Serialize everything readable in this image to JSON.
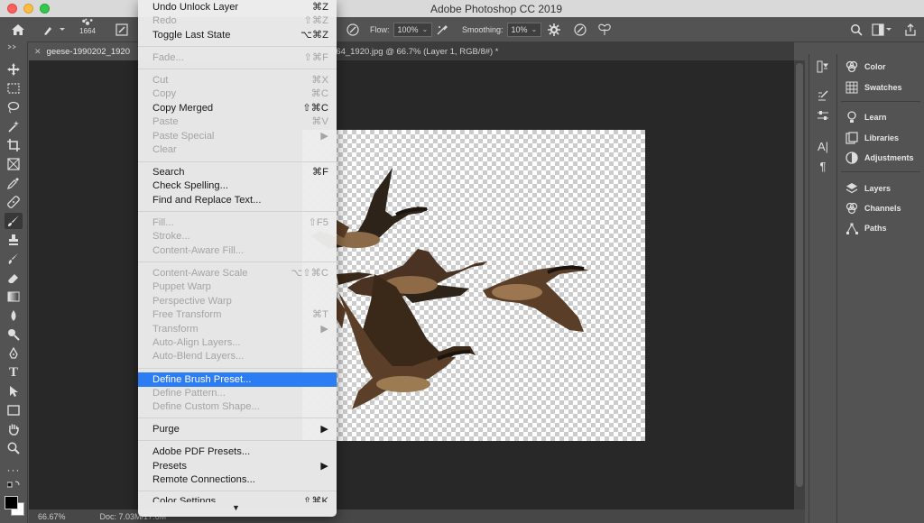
{
  "app": {
    "title": "Adobe Photoshop CC 2019"
  },
  "options_bar": {
    "brush_size": "1664",
    "flow_label": "Flow:",
    "flow_value": "100%",
    "smoothing_label": "Smoothing:",
    "smoothing_value": "10%"
  },
  "tabs": [
    {
      "label": "geese-1990202_1920"
    },
    {
      "label": "564_1920.jpg @ 66.7% (Layer 1, RGB/8#) *"
    }
  ],
  "status": {
    "zoom": "66.67%",
    "doc": "Doc: 7.03M/17.6M"
  },
  "menu": {
    "items": [
      {
        "label": "Undo Unlock Layer",
        "shortcut": "⌘Z"
      },
      {
        "label": "Redo",
        "shortcut": "⇧⌘Z"
      },
      {
        "label": "Toggle Last State",
        "shortcut": "⌥⌘Z"
      },
      {
        "label": "Fade...",
        "shortcut": "⇧⌘F"
      },
      {
        "label": "Cut",
        "shortcut": "⌘X"
      },
      {
        "label": "Copy",
        "shortcut": "⌘C"
      },
      {
        "label": "Copy Merged",
        "shortcut": "⇧⌘C"
      },
      {
        "label": "Paste",
        "shortcut": "⌘V"
      },
      {
        "label": "Paste Special",
        "shortcut": "▶"
      },
      {
        "label": "Clear",
        "shortcut": ""
      },
      {
        "label": "Search",
        "shortcut": "⌘F"
      },
      {
        "label": "Check Spelling...",
        "shortcut": ""
      },
      {
        "label": "Find and Replace Text...",
        "shortcut": ""
      },
      {
        "label": "Fill...",
        "shortcut": "⇧F5"
      },
      {
        "label": "Stroke...",
        "shortcut": ""
      },
      {
        "label": "Content-Aware Fill...",
        "shortcut": ""
      },
      {
        "label": "Content-Aware Scale",
        "shortcut": "⌥⇧⌘C"
      },
      {
        "label": "Puppet Warp",
        "shortcut": ""
      },
      {
        "label": "Perspective Warp",
        "shortcut": ""
      },
      {
        "label": "Free Transform",
        "shortcut": "⌘T"
      },
      {
        "label": "Transform",
        "shortcut": "▶"
      },
      {
        "label": "Auto-Align Layers...",
        "shortcut": ""
      },
      {
        "label": "Auto-Blend Layers...",
        "shortcut": ""
      },
      {
        "label": "Define Brush Preset...",
        "shortcut": ""
      },
      {
        "label": "Define Pattern...",
        "shortcut": ""
      },
      {
        "label": "Define Custom Shape...",
        "shortcut": ""
      },
      {
        "label": "Purge",
        "shortcut": "▶"
      },
      {
        "label": "Adobe PDF Presets...",
        "shortcut": ""
      },
      {
        "label": "Presets",
        "shortcut": "▶"
      },
      {
        "label": "Remote Connections...",
        "shortcut": ""
      },
      {
        "label": "Color Settings...",
        "shortcut": "⇧⌘K"
      }
    ],
    "more_arrow": "▼"
  },
  "panels": {
    "items": [
      {
        "label": "Color",
        "icon": "color-icon"
      },
      {
        "label": "Swatches",
        "icon": "swatches-icon"
      },
      {
        "label": "Learn",
        "icon": "learn-icon"
      },
      {
        "label": "Libraries",
        "icon": "libraries-icon"
      },
      {
        "label": "Adjustments",
        "icon": "adjustments-icon"
      },
      {
        "label": "Layers",
        "icon": "layers-icon"
      },
      {
        "label": "Channels",
        "icon": "channels-icon"
      },
      {
        "label": "Paths",
        "icon": "paths-icon"
      }
    ]
  },
  "colors": {
    "accent": "#2c7cf4",
    "ui_bg": "#535353",
    "canvas_bg": "#282828"
  }
}
